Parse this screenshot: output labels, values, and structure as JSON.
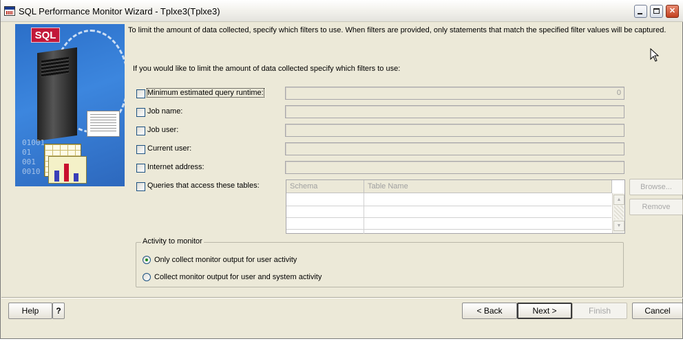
{
  "window": {
    "title": "SQL Performance Monitor Wizard - Tplxe3(Tplxe3)",
    "controls": {
      "minimize_icon": "minimize-icon",
      "maximize_icon": "maximize-icon",
      "close_icon": "close-icon",
      "close_glyph": "✕"
    }
  },
  "intro_text": "To limit the amount of data collected, specify which filters to use.  When filters are provided, only statements that match the specified filter values will be captured.",
  "filter_prompt": "If you would like to limit the amount of data collected specify which filters to use:",
  "filters": [
    {
      "label": "Minimum estimated query runtime:",
      "checked": false,
      "value": "0"
    },
    {
      "label": "Job name:",
      "checked": false,
      "value": ""
    },
    {
      "label": "Job user:",
      "checked": false,
      "value": ""
    },
    {
      "label": "Current user:",
      "checked": false,
      "value": ""
    },
    {
      "label": "Internet address:",
      "checked": false,
      "value": ""
    },
    {
      "label": "Queries that access these tables:",
      "checked": false
    }
  ],
  "tables": {
    "columns": [
      "Schema",
      "Table Name"
    ],
    "scroll_up": "▲",
    "scroll_down": "▼"
  },
  "side_buttons": {
    "browse": "Browse...",
    "remove": "Remove"
  },
  "activity": {
    "title": "Activity to monitor",
    "options": [
      {
        "label": "Only collect monitor output for user activity",
        "selected": true
      },
      {
        "label": "Collect monitor output for user and system activity",
        "selected": false
      }
    ]
  },
  "artwork": {
    "badge": "SQL",
    "binary": "01001\n01\n001\n0010"
  },
  "footer": {
    "help": "Help",
    "help_icon": "?",
    "back": "< Back",
    "next": "Next >",
    "finish": "Finish",
    "cancel": "Cancel"
  },
  "colors": {
    "accent": "#2b6fc8",
    "badge": "#c2183a",
    "window_bg": "#ece9d8"
  }
}
